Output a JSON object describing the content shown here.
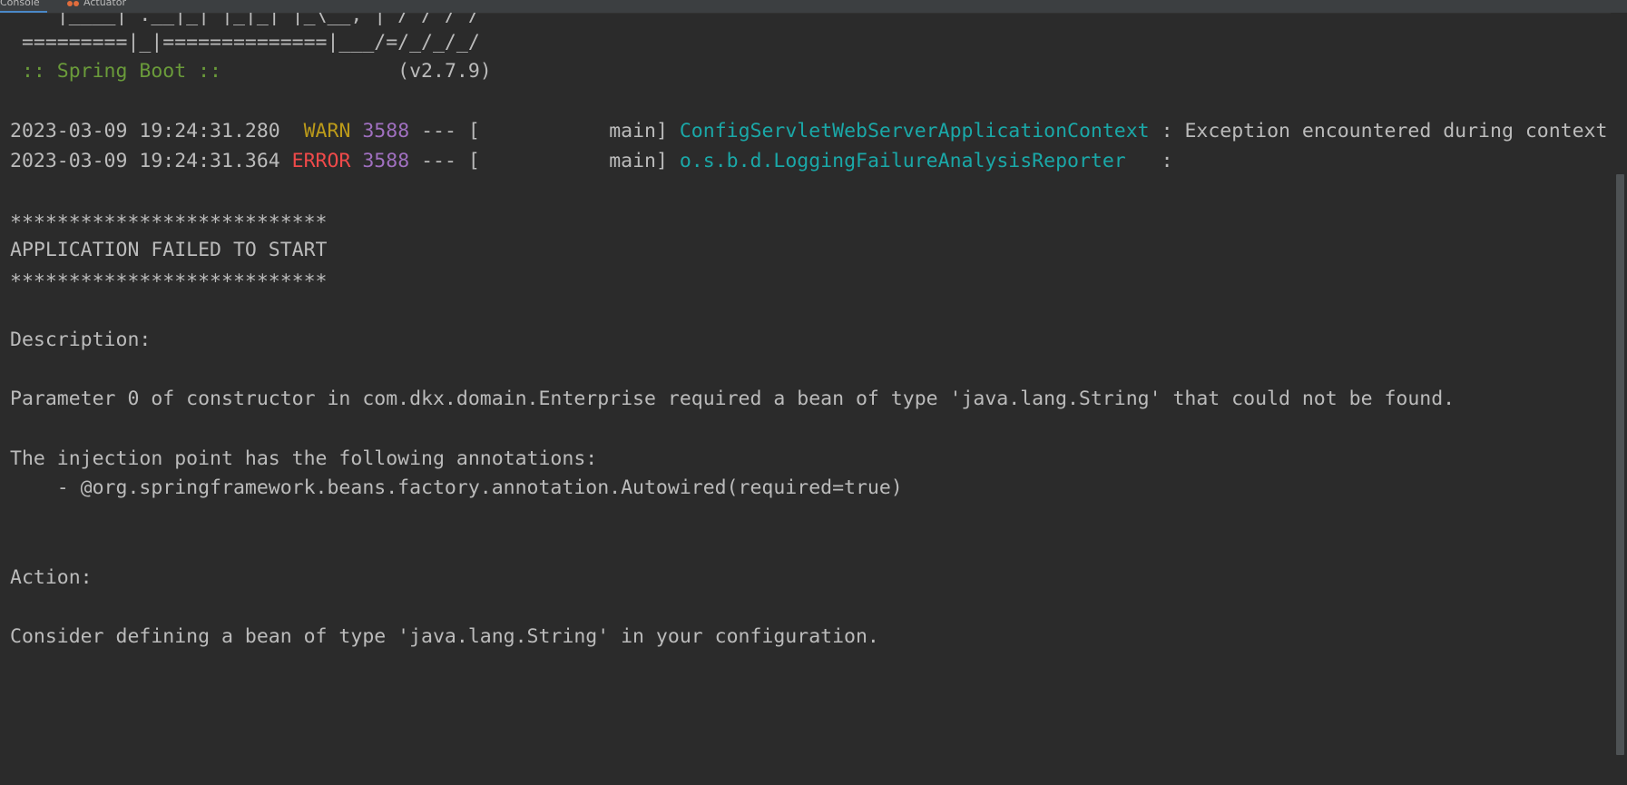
{
  "tabs": [
    {
      "label": "Console"
    },
    {
      "label": "Actuator"
    }
  ],
  "colors": {
    "background": "#2b2b2b",
    "text": "#bbbbbb",
    "warn": "#bb9a1a",
    "error": "#f04a4a",
    "pid": "#a070c0",
    "logger": "#1aa8a8",
    "banner": "#6a9b3a"
  },
  "console": {
    "banner": {
      "line1": "    |____| .__|_| |_|_| |_\\__, | / / / /",
      "line2": " =========|_|==============|___/=/_/_/_/",
      "spring_label": " :: Spring Boot :: ",
      "version": "              (v2.7.9)"
    },
    "logs": [
      {
        "timestamp": "2023-03-09 19:24:31.280",
        "level": " WARN",
        "pid": "3588",
        "sep": " --- [           main] ",
        "logger": "ConfigServletWebServerApplicationContext",
        "message": " : Exception encountered during context initialization - cancelling refresh attempt"
      },
      {
        "timestamp": "2023-03-09 19:24:31.364",
        "level": "ERROR",
        "pid": "3588",
        "sep": " --- [           main] ",
        "logger": "o.s.b.d.LoggingFailureAnalysisReporter",
        "message": "   : "
      }
    ],
    "stars1": "***************************",
    "failed": "APPLICATION FAILED TO START",
    "stars2": "***************************",
    "description_heading": "Description:",
    "description_text": "Parameter 0 of constructor in com.dkx.domain.Enterprise required a bean of type 'java.lang.String' that could not be found.",
    "injection_heading": "The injection point has the following annotations:",
    "annotation": "    - @org.springframework.beans.factory.annotation.Autowired(required=true)",
    "action_heading": "Action:",
    "action_text": "Consider defining a bean of type 'java.lang.String' in your configuration."
  }
}
